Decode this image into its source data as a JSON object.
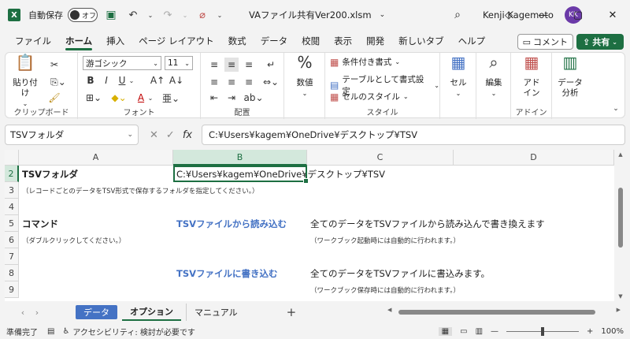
{
  "titlebar": {
    "autosave_label": "自動保存",
    "autosave_state": "オフ",
    "filename": "VAファイル共有Ver200.xlsm",
    "username": "Kenji Kagemoto",
    "avatar_initials": "KK"
  },
  "ribbon_tabs": [
    "ファイル",
    "ホーム",
    "挿入",
    "ページ レイアウト",
    "数式",
    "データ",
    "校閲",
    "表示",
    "開発",
    "新しいタブ",
    "ヘルプ"
  ],
  "active_tab_index": 1,
  "actions": {
    "comment": "コメント",
    "share": "共有"
  },
  "ribbon": {
    "clipboard": {
      "paste": "貼り付け",
      "label": "クリップボード"
    },
    "font": {
      "name": "游ゴシック",
      "size": "11",
      "label": "フォント",
      "bold": "B",
      "italic": "I",
      "underline": "U",
      "font_color": "A"
    },
    "alignment": {
      "label": "配置"
    },
    "number": {
      "format": "数値"
    },
    "styles": {
      "conditional": "条件付き書式",
      "table": "テーブルとして書式設定",
      "cell_style": "セルのスタイル",
      "label": "スタイル"
    },
    "cells": {
      "label": "セル"
    },
    "editing": {
      "label": "編集"
    },
    "addin": {
      "label": "アドイン",
      "name": "アド\nイン"
    },
    "analysis": {
      "label": "データ\n分析"
    }
  },
  "formula_bar": {
    "name_box": "TSVフォルダ",
    "formula": "C:¥Users¥kagem¥OneDrive¥デスクトップ¥TSV"
  },
  "columns": [
    "A",
    "B",
    "C",
    "D"
  ],
  "selected_column": "B",
  "rows": [
    "2",
    "3",
    "4",
    "5",
    "6",
    "7",
    "8",
    "9"
  ],
  "selected_row": "2",
  "cells": {
    "a2": "TSVフォルダ",
    "b2": "C:¥Users¥kagem¥OneDrive¥デスクトップ¥TSV",
    "a3": "（レコードごとのデータをTSV形式で保存するフォルダを指定してください。）",
    "a5": "コマンド",
    "b5": "TSVファイルから読み込む",
    "c5": "全てのデータをTSVファイルから読み込んで書き換えます",
    "a6": "（ダブルクリックしてください。）",
    "c6": "（ワークブック起動時には自動的に行われます。）",
    "b8": "TSVファイルに書き込む",
    "c8": "全てのデータをTSVファイルに書込みます。",
    "c9": "（ワークブック保存時には自動的に行われます。）"
  },
  "sheets": [
    "データ",
    "オプション",
    "マニュアル"
  ],
  "active_sheet": "オプション",
  "status": {
    "ready": "準備完了",
    "accessibility": "アクセシビリティ: 検討が必要です",
    "zoom": "100%"
  },
  "colors": {
    "excel_green": "#1d6f42",
    "link_blue": "#4472c4"
  }
}
